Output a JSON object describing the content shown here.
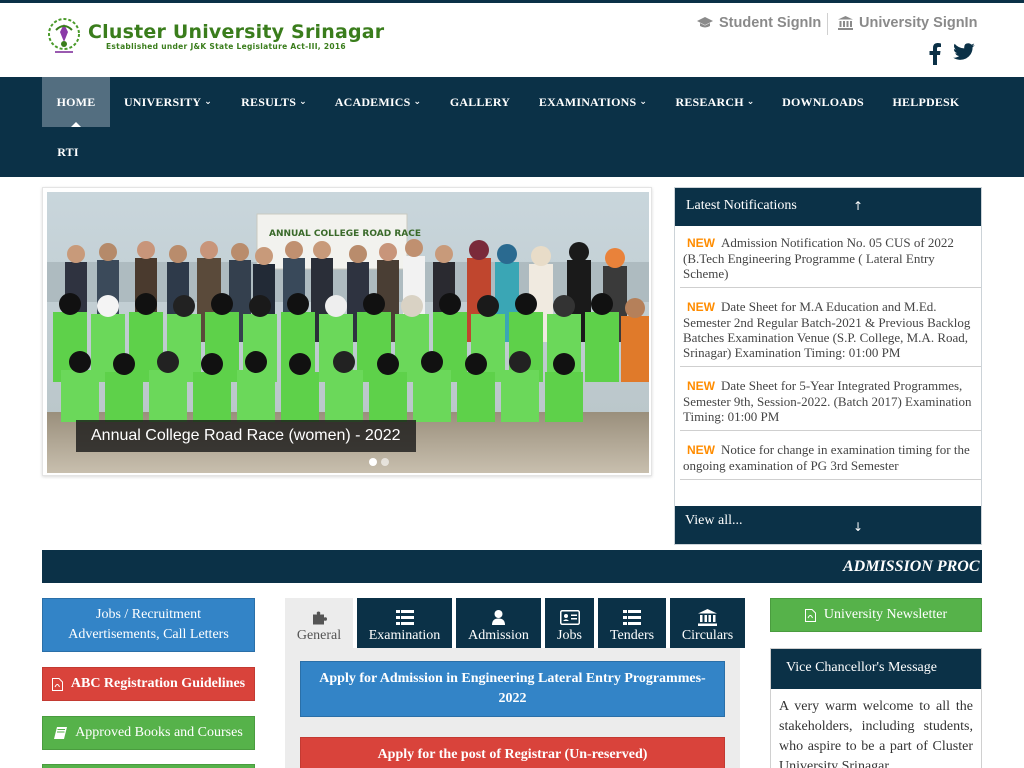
{
  "header": {
    "brand_title": "Cluster University Srinagar",
    "brand_subtitle": "Established under J&K State Legislature Act-III, 2016",
    "student_signin": "Student SignIn",
    "university_signin": "University SignIn"
  },
  "nav": {
    "items": [
      {
        "label": "HOME",
        "dropdown": false
      },
      {
        "label": "UNIVERSITY",
        "dropdown": true
      },
      {
        "label": "RESULTS",
        "dropdown": true
      },
      {
        "label": "ACADEMICS",
        "dropdown": true
      },
      {
        "label": "GALLERY",
        "dropdown": false
      },
      {
        "label": "EXAMINATIONS",
        "dropdown": true
      },
      {
        "label": "RESEARCH",
        "dropdown": true
      },
      {
        "label": "DOWNLOADS",
        "dropdown": false
      },
      {
        "label": "HELPDESK",
        "dropdown": false
      },
      {
        "label": "RTI",
        "dropdown": false
      }
    ]
  },
  "slider": {
    "caption": "Annual College Road Race (women) - 2022"
  },
  "notifications": {
    "title": "Latest Notifications",
    "new_badge": "NEW",
    "items": [
      "Admission Notification No. 05 CUS of 2022 (B.Tech Engineering Programme ( Lateral Entry Scheme)",
      "Date Sheet for M.A Education and M.Ed. Semester 2nd Regular Batch-2021 & Previous Backlog Batches Examination Venue (S.P. College, M.A. Road, Srinagar) Examination Timing: 01:00 PM",
      "Date Sheet for 5-Year Integrated Programmes, Semester 9th, Session-2022. (Batch 2017) Examination Timing: 01:00 PM",
      "Notice for change in examination timing for the ongoing examination of PG 3rd Semester"
    ],
    "view_all": "View all..."
  },
  "marquee": {
    "text": "ADMISSION PROC"
  },
  "left_buttons": {
    "jobs": "Jobs / Recruitment Advertisements, Call Letters",
    "abc": "ABC Registration Guidelines",
    "books": "Approved Books and Courses"
  },
  "tabs": {
    "items": [
      "General",
      "Examination",
      "Admission",
      "Jobs",
      "Tenders",
      "Circulars"
    ],
    "active": "General"
  },
  "general_panel": {
    "apply_engineering": "Apply for Admission in Engineering Lateral Entry Programmes-2022",
    "apply_registrar": "Apply for the post of Registrar (Un-reserved)"
  },
  "right_column": {
    "newsletter": "University Newsletter",
    "vc_title": "Vice Chancellor's Message",
    "vc_text": "A very warm welcome to all the stakeholders, including students, who aspire to be a part of Cluster University Srinagar"
  },
  "colors": {
    "nav_bg": "#0b3147",
    "home_active": "#536e80",
    "primary_blue": "#3384c7",
    "danger_red": "#d9433b",
    "success_green": "#56b24a",
    "new_badge": "#ff8c00",
    "brand_green": "#3a7d1c"
  },
  "icons": {
    "student_signin": "graduation-cap-icon",
    "university_signin": "institution-icon",
    "facebook": "facebook-icon",
    "twitter": "twitter-icon",
    "notif_up": "arrow-up-icon",
    "notif_down": "arrow-down-icon",
    "abc": "pdf-file-icon",
    "books": "book-icon",
    "newsletter": "pdf-file-icon",
    "tab_general": "puzzle-icon",
    "tab_examination": "list-icon",
    "tab_admission": "user-icon",
    "tab_jobs": "id-card-icon",
    "tab_tenders": "list-icon",
    "tab_circulars": "institution-icon"
  }
}
